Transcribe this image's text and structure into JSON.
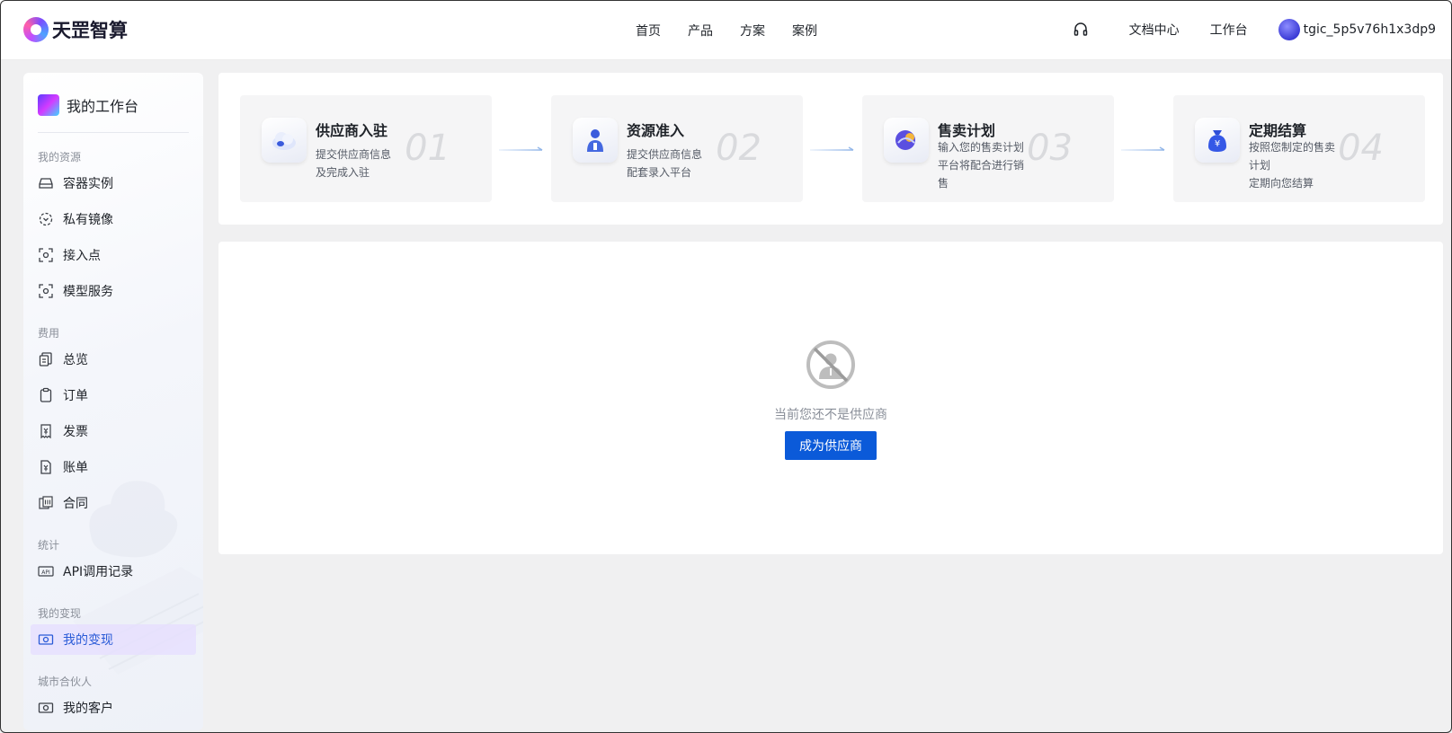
{
  "header": {
    "logo_text": "天罡智算",
    "nav": [
      "首页",
      "产品",
      "方案",
      "案例"
    ],
    "docs_link": "文档中心",
    "workbench_link": "工作台",
    "username": "tgic_5p5v76h1x3dp9",
    "support_icon": "headset-icon"
  },
  "sidebar": {
    "title": "我的工作台",
    "sections": {
      "resources": "我的资源",
      "billing": "费用",
      "stats": "统计",
      "monetize": "我的变现",
      "partner": "城市合伙人"
    },
    "items": {
      "container": "容器实例",
      "private_image": "私有镜像",
      "access_point": "接入点",
      "model_service": "模型服务",
      "overview": "总览",
      "orders": "订单",
      "invoice": "发票",
      "bill": "账单",
      "contract": "合同",
      "api_log": "API调用记录",
      "my_monetize": "我的变现",
      "my_customers": "我的客户"
    },
    "active_item": "我的变现",
    "accent_color": "#2a5bd7"
  },
  "steps": [
    {
      "title": "供应商入驻",
      "desc": [
        "提交供应商信息",
        "及完成入驻"
      ],
      "num": "01"
    },
    {
      "title": "资源准入",
      "desc": [
        "提交供应商信息",
        "配套录入平台"
      ],
      "num": "02"
    },
    {
      "title": "售卖计划",
      "desc": [
        "输入您的售卖计划",
        "平台将配合进行销",
        "售"
      ],
      "num": "03"
    },
    {
      "title": "定期结算",
      "desc": [
        "按照您制定的售卖",
        "计划",
        "定期向您结算"
      ],
      "num": "04"
    }
  ],
  "empty_state": {
    "message": "当前您还不是供应商",
    "button_label": "成为供应商",
    "button_color": "#0b5ad9"
  }
}
